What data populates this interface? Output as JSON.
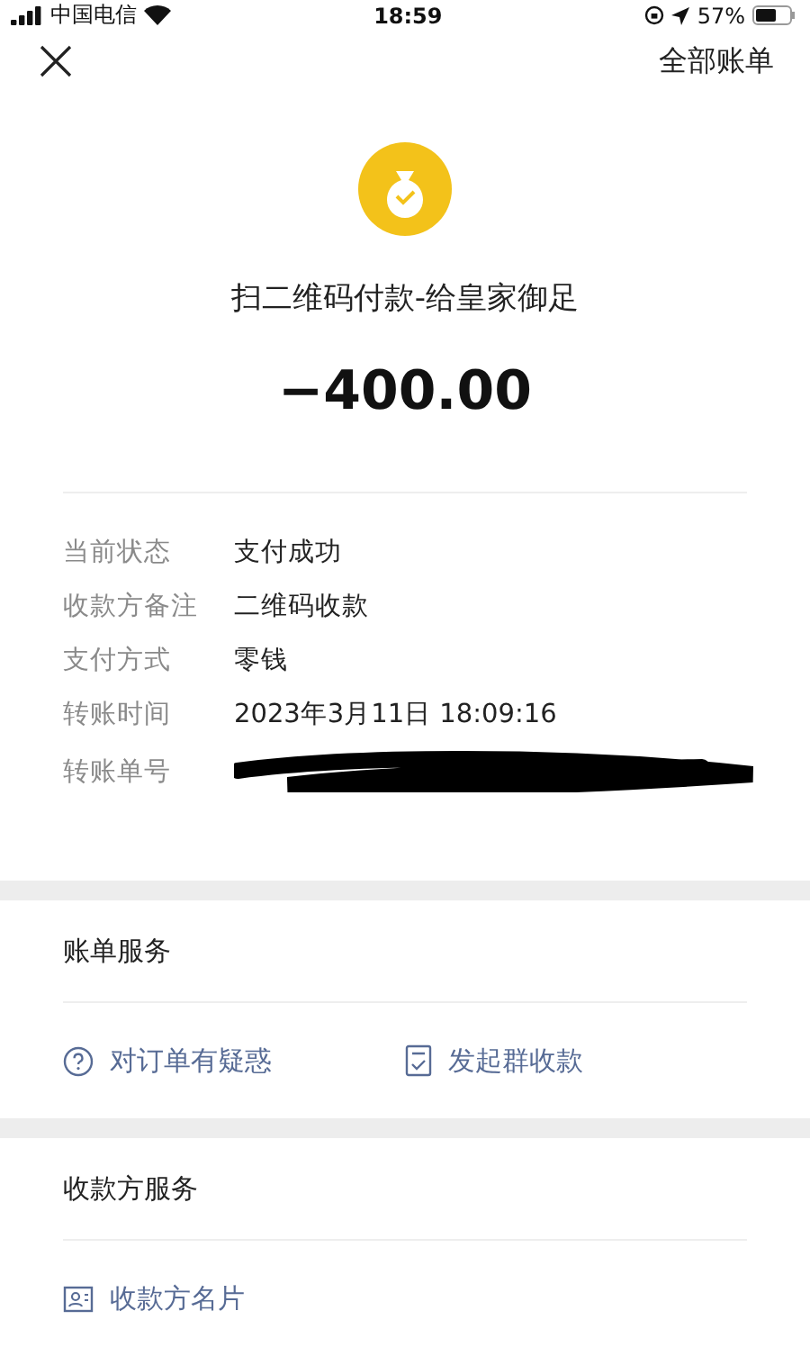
{
  "status_bar": {
    "carrier": "中国电信",
    "time": "18:59",
    "battery": "57%"
  },
  "nav": {
    "action": "全部账单"
  },
  "payment": {
    "title": "扫二维码付款-给皇家御足",
    "amount": "−400.00"
  },
  "details": [
    {
      "kind": "text",
      "label": "当前状态",
      "value": "支付成功"
    },
    {
      "kind": "text",
      "label": "收款方备注",
      "value": "二维码收款"
    },
    {
      "kind": "text",
      "label": "支付方式",
      "value": "零钱"
    },
    {
      "kind": "text",
      "label": "转账时间",
      "value": "2023年3月11日 18:09:16"
    },
    {
      "kind": "redacted",
      "label": "转账单号"
    }
  ],
  "bill_service": {
    "title": "账单服务",
    "actions": [
      {
        "kind": "question",
        "label": "对订单有疑惑"
      },
      {
        "kind": "checklist",
        "label": "发起群收款"
      }
    ]
  },
  "payee_service": {
    "title": "收款方服务",
    "actions": [
      {
        "kind": "card",
        "label": "收款方名片"
      }
    ]
  }
}
